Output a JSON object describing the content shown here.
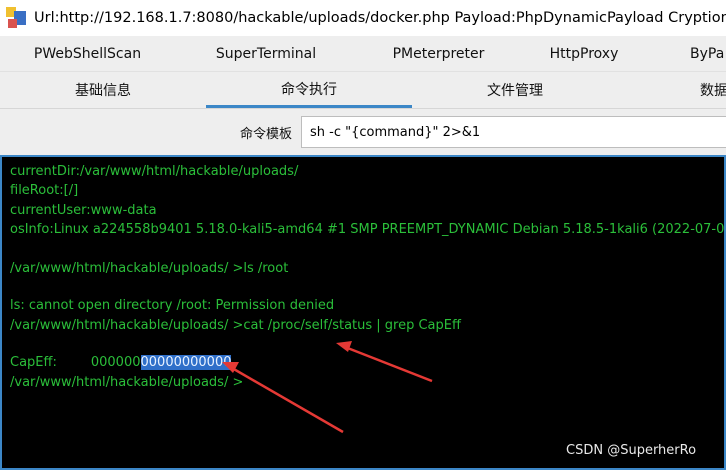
{
  "window": {
    "title": "Url:http://192.168.1.7:8080/hackable/uploads/docker.php Payload:PhpDynamicPayload Cryption:PHP_EVAL"
  },
  "tabs_row1": [
    "PWebShellScan",
    "SuperTerminal",
    "PMeterpreter",
    "HttpProxy",
    "ByPa"
  ],
  "tabs_row2": [
    "基础信息",
    "命令执行",
    "文件管理",
    "数据"
  ],
  "active_tab": "命令执行",
  "command": {
    "label": "命令模板",
    "template": "sh -c \"{command}\" 2>&1"
  },
  "terminal": {
    "text_color": "#2bbf3a",
    "selection_color": "#2f6fc9",
    "lines": [
      "currentDir:/var/www/html/hackable/uploads/",
      "fileRoot:[/]",
      "currentUser:www-data",
      "osInfo:Linux a224558b9401 5.18.0-kali5-amd64 #1 SMP PREEMPT_DYNAMIC Debian 5.18.5-1kali6 (2022-07-07",
      "/var/www/html/hackable/uploads/ >ls /root",
      "ls: cannot open directory /root: Permission denied",
      "/var/www/html/hackable/uploads/ >cat /proc/self/status | grep CapEff",
      "/var/www/html/hackable/uploads/ >"
    ],
    "capeff": {
      "label": "CapEff:",
      "value_plain": "000000",
      "value_selected": "00000000000"
    }
  },
  "annotation": {
    "arrow_color": "#e53935"
  },
  "watermark": "CSDN @SuperherRo"
}
